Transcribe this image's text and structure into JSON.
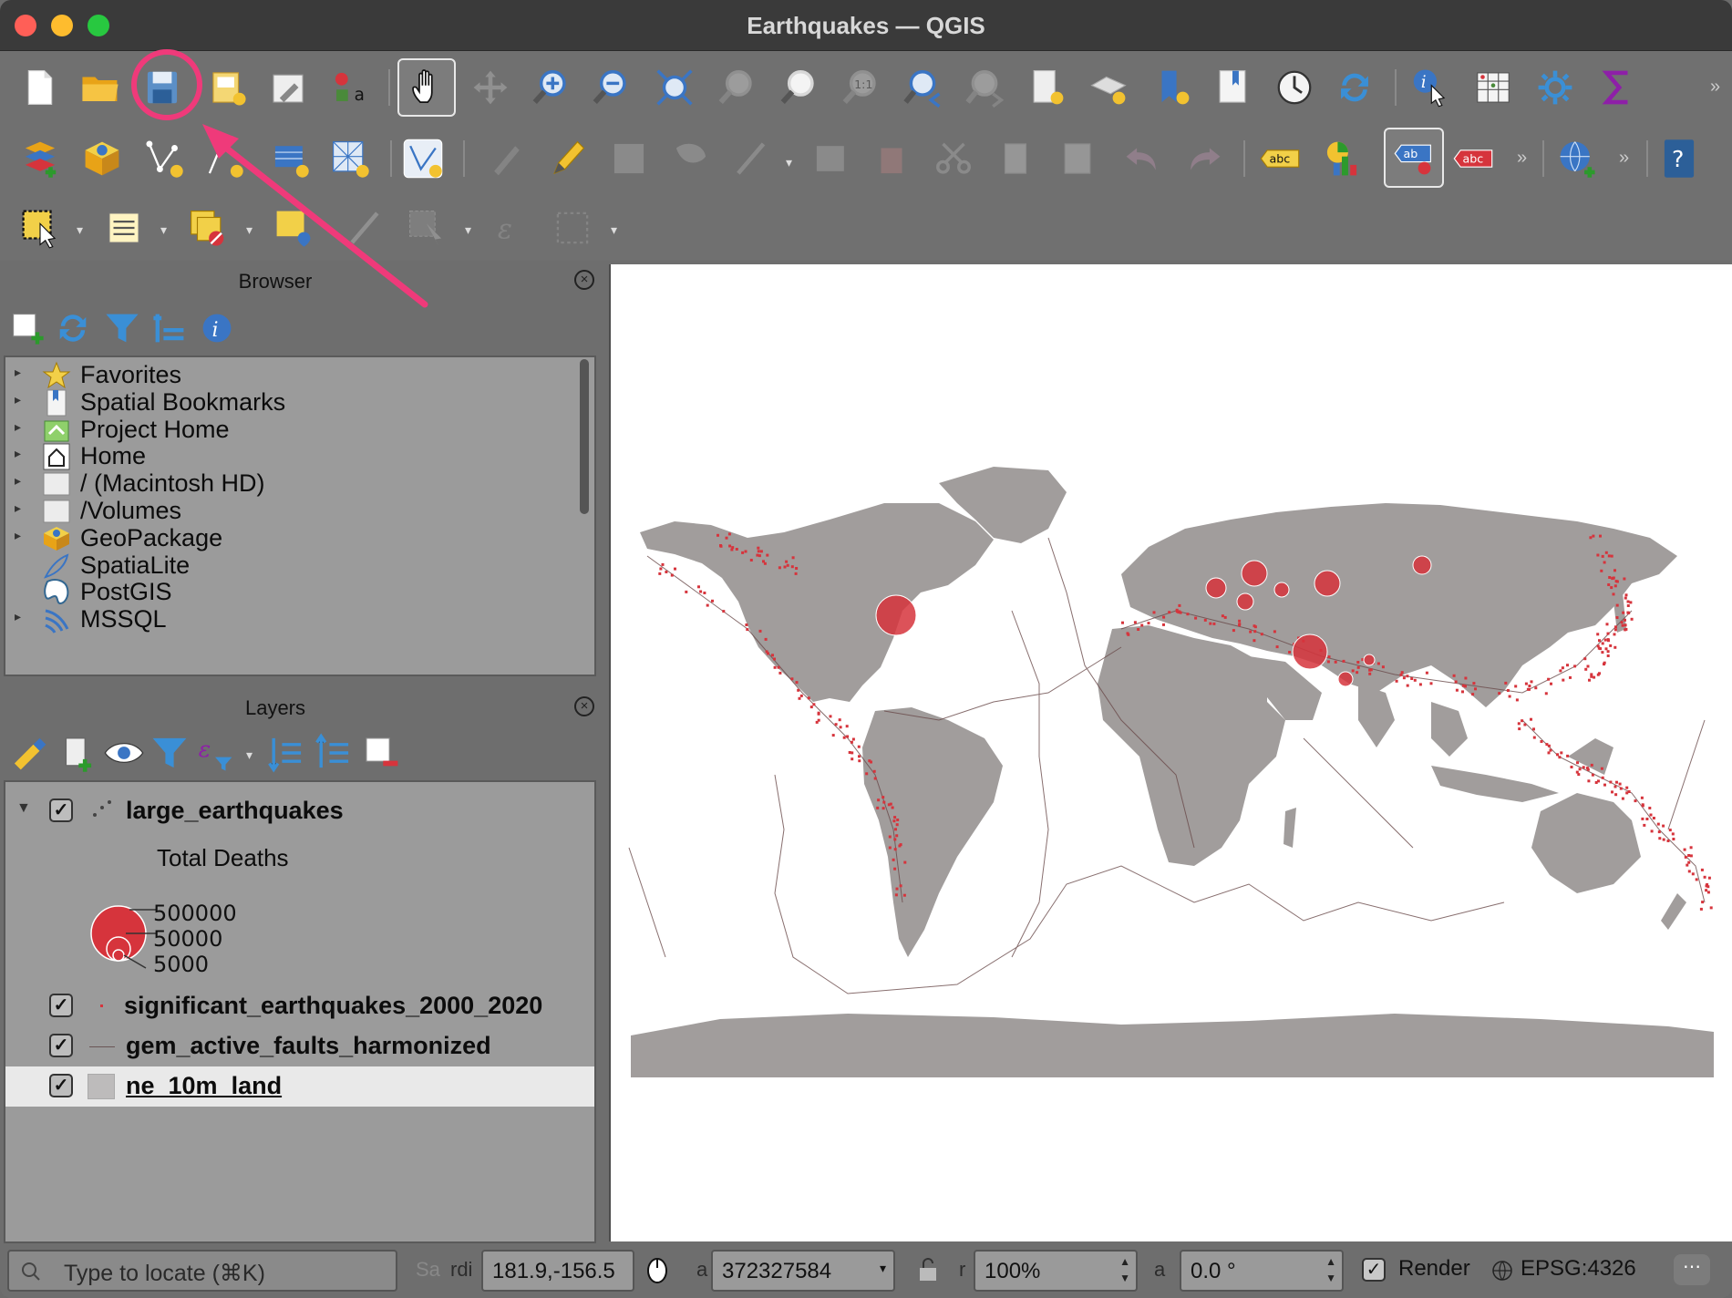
{
  "window": {
    "title": "Earthquakes — QGIS"
  },
  "toolbar1": {
    "icons": [
      "new-project-icon",
      "open-project-icon",
      "save-project-icon",
      "new-print-layout-icon",
      "style-manager-icon",
      "layer-styling-icon",
      "pan-icon",
      "pan-to-selection-icon",
      "zoom-in-icon",
      "zoom-out-icon",
      "zoom-full-icon",
      "zoom-to-selection-icon",
      "zoom-to-layer-icon",
      "zoom-native-icon",
      "zoom-last-icon",
      "zoom-next-icon",
      "new-map-view-icon",
      "new-3d-map-view-icon",
      "new-bookmark-icon",
      "show-bookmarks-icon",
      "temporal-controller-icon",
      "refresh-icon",
      "identify-icon",
      "attribute-table-icon",
      "settings-icon",
      "statistics-icon"
    ]
  },
  "toolbar2": {
    "icons": [
      "data-source-manager-icon",
      "new-geopackage-layer-icon",
      "new-shapefile-layer-icon",
      "new-temp-layer-icon",
      "new-virtual-layer-icon",
      "new-spatialite-layer-icon",
      "digitize-icon",
      "current-edits-icon",
      "toggle-editing-icon",
      "save-edits-icon",
      "add-polygon-icon",
      "vertex-tool-icon",
      "modify-attributes-icon",
      "delete-selected-icon",
      "cut-features-icon",
      "copy-features-icon",
      "paste-features-icon",
      "undo-icon",
      "redo-icon",
      "label-toolbar-icon",
      "diagram-icon",
      "highlight-label-icon",
      "label-red-icon",
      "web-services-icon",
      "help-icon"
    ]
  },
  "toolbar3": {
    "icons": [
      "select-features-icon",
      "select-by-value-icon",
      "deselect-icon",
      "select-location-icon",
      "measure-icon",
      "identify-features-icon",
      "field-calculator-icon",
      "expression-icon"
    ]
  },
  "annotation": {
    "color": "#ef3a7a",
    "highlighted_tool": "save-project-icon"
  },
  "browser": {
    "title": "Browser",
    "toolbar_icons": [
      "add-selected-icon",
      "refresh-icon",
      "filter-icon",
      "collapse-all-icon",
      "properties-icon"
    ],
    "items": [
      {
        "label": "Favorites",
        "icon": "star-icon",
        "expandable": true
      },
      {
        "label": "Spatial Bookmarks",
        "icon": "bookmark-icon",
        "expandable": true
      },
      {
        "label": "Project Home",
        "icon": "project-home-icon",
        "expandable": true
      },
      {
        "label": "Home",
        "icon": "home-icon",
        "expandable": true
      },
      {
        "label": "/ (Macintosh HD)",
        "icon": "folder-icon",
        "expandable": true
      },
      {
        "label": "/Volumes",
        "icon": "folder-icon",
        "expandable": true
      },
      {
        "label": "GeoPackage",
        "icon": "geopackage-icon",
        "expandable": true
      },
      {
        "label": "SpatiaLite",
        "icon": "spatialite-icon",
        "expandable": false
      },
      {
        "label": "PostGIS",
        "icon": "postgis-icon",
        "expandable": false
      },
      {
        "label": "MSSQL",
        "icon": "mssql-icon",
        "expandable": true
      }
    ]
  },
  "layers": {
    "title": "Layers",
    "toolbar_icons": [
      "open-styling-icon",
      "add-group-icon",
      "manage-visibility-icon",
      "filter-legend-icon",
      "filter-expression-icon",
      "expand-all-icon",
      "collapse-all-icon",
      "remove-layer-icon"
    ],
    "items": [
      {
        "name": "large_earthquakes",
        "checked": true,
        "expanded": true,
        "selected": false
      },
      {
        "name": "significant_earthquakes_2000_2020",
        "checked": true,
        "selected": false
      },
      {
        "name": "gem_active_faults_harmonized",
        "checked": true,
        "selected": false
      },
      {
        "name": "ne_10m_land",
        "checked": true,
        "selected": true
      }
    ],
    "legend": {
      "title": "Total Deaths",
      "values": [
        "500000",
        "50000",
        "5000"
      ],
      "color": "#d6343c"
    }
  },
  "map": {
    "background": "#ffffff",
    "land_color": "#a19d9c",
    "point_color": "#d6343c",
    "fault_color": "#6a4a4a"
  },
  "statusbar": {
    "locator_placeholder": "Type to locate (⌘K)",
    "coordinate_label": "Sa",
    "coordinate_label2": "rdi",
    "coordinate": "181.9,-156.5",
    "scale_label": "a",
    "scale": "372327584",
    "magnifier_label": "r",
    "magnifier": "100%",
    "rotation_label": "a",
    "rotation": "0.0 °",
    "render_label": "Render",
    "render_checked": true,
    "crs": "EPSG:4326"
  }
}
